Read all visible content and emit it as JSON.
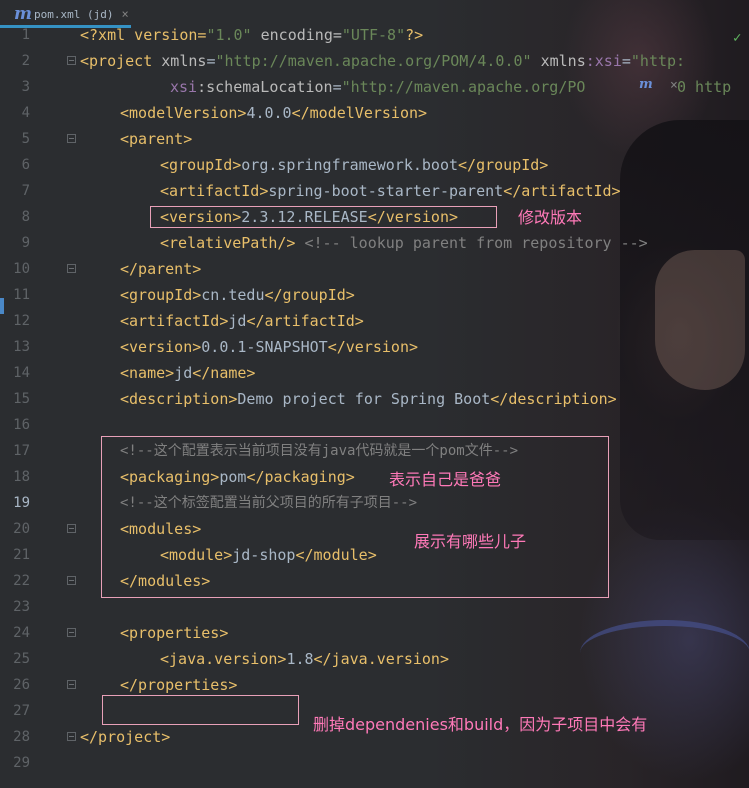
{
  "tab": {
    "label": "pom.xml (jd)",
    "close": "×",
    "icon": "maven-m-icon"
  },
  "inspection": "✓",
  "line_numbers": [
    "1",
    "2",
    "3",
    "4",
    "5",
    "6",
    "7",
    "8",
    "9",
    "10",
    "11",
    "12",
    "13",
    "14",
    "15",
    "16",
    "17",
    "18",
    "19",
    "20",
    "21",
    "22",
    "23",
    "24",
    "25",
    "26",
    "27",
    "28",
    "29"
  ],
  "code": {
    "l1": {
      "a": "<?xml version=",
      "b": "\"1.0\"",
      "c": " encoding=",
      "d": "\"UTF-8\"",
      "e": "?>"
    },
    "l2": {
      "a": "<project",
      "b": " xmlns",
      "c": "=",
      "d": "\"http://maven.apache.org/POM/4.0.0\"",
      "e": " xmlns",
      "f": ":xsi",
      "g": "=",
      "h": "\"http:"
    },
    "l3": {
      "a": "xsi",
      "b": ":schemaLocation",
      "c": "=",
      "d": "\"http://maven.apache.org/PO",
      "e": "0 http"
    },
    "l4": {
      "o": "<modelVersion>",
      "v": "4.0.0",
      "c": "</modelVersion>"
    },
    "l5": {
      "o": "<parent>"
    },
    "l6": {
      "o": "<groupId>",
      "v": "org.springframework.boot",
      "c": "</groupId>"
    },
    "l7": {
      "o": "<artifactId>",
      "v": "spring-boot-starter-parent",
      "c": "</artifactId>"
    },
    "l8": {
      "o": "<version>",
      "v": "2.3.12.RELEASE",
      "c": "</version>"
    },
    "l9": {
      "o": "<relativePath/>",
      "cm": " <!-- lookup parent from repository -->"
    },
    "l10": {
      "o": "</parent>"
    },
    "l11": {
      "o": "<groupId>",
      "v": "cn.tedu",
      "c": "</groupId>"
    },
    "l12": {
      "o": "<artifactId>",
      "v": "jd",
      "c": "</artifactId>"
    },
    "l13": {
      "o": "<version>",
      "v": "0.0.1-SNAPSHOT",
      "c": "</version>"
    },
    "l14": {
      "o": "<name>",
      "v": "jd",
      "c": "</name>"
    },
    "l15": {
      "o": "<description>",
      "v": "Demo project for Spring Boot",
      "c": "</description>"
    },
    "l17": {
      "cm": "<!--这个配置表示当前项目没有java代码就是一个pom文件-->"
    },
    "l18": {
      "o": "<packaging>",
      "v": "pom",
      "c": "</packaging>"
    },
    "l19": {
      "cm": "<!--这个标签配置当前父项目的所有子项目-->"
    },
    "l20": {
      "o": "<modules>"
    },
    "l21": {
      "o": "<module>",
      "v": "jd-shop",
      "c": "</module>"
    },
    "l22": {
      "o": "</modules>"
    },
    "l24": {
      "o": "<properties>"
    },
    "l25": {
      "o": "<java.version>",
      "v": "1.8",
      "c": "</java.version>"
    },
    "l26": {
      "o": "</properties>"
    },
    "l28": {
      "o": "</project>"
    }
  },
  "annotations": {
    "version_note": "修改版本",
    "packaging_note": "表示自己是爸爸",
    "modules_note": "展示有哪些儿子",
    "deps_note": "删掉dependenies和build，因为子项目中会有"
  },
  "colors": {
    "annotation": "#ff79b8",
    "box": "#e8a0b8",
    "tag": "#e8bf6a",
    "string": "#6a8759",
    "comment": "#808080"
  }
}
